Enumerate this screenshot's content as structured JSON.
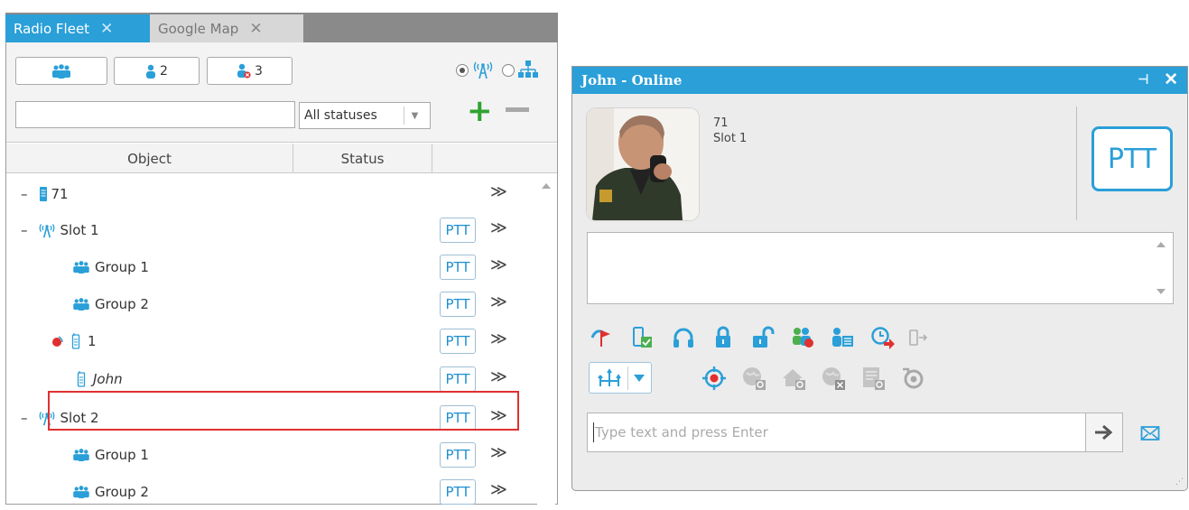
{
  "tabs": [
    {
      "label": "Radio Fleet",
      "close": "✕"
    },
    {
      "label": "Google Map",
      "close": "✕"
    }
  ],
  "filters": {
    "all_count": "",
    "online_count": "2",
    "offline_count": "3",
    "search_value": "",
    "status_select": "All statuses"
  },
  "columns": {
    "object": "Object",
    "status": "Status"
  },
  "tree": [
    {
      "prefix": "–",
      "label": "71",
      "icon": "repeater-icon",
      "italic": false,
      "ptt": false
    },
    {
      "prefix": "–",
      "label": "Slot 1",
      "icon": "antenna-icon",
      "italic": false,
      "ptt": true
    },
    {
      "prefix": "",
      "label": "Group 1",
      "icon": "talkgroup-icon",
      "italic": false,
      "ptt": true
    },
    {
      "prefix": "",
      "label": "Group 2",
      "icon": "talkgroup-icon",
      "italic": false,
      "ptt": true
    },
    {
      "prefix": "",
      "label": "1",
      "icon": "radio-icon",
      "italic": false,
      "ptt": true
    },
    {
      "prefix": "",
      "label": "John",
      "icon": "radio-icon",
      "italic": true,
      "ptt": true
    },
    {
      "prefix": "–",
      "label": "Slot 2",
      "icon": "antenna-icon",
      "italic": false,
      "ptt": true
    },
    {
      "prefix": "",
      "label": "Group 1",
      "icon": "talkgroup-icon",
      "italic": false,
      "ptt": true
    },
    {
      "prefix": "",
      "label": "Group 2",
      "icon": "talkgroup-icon",
      "italic": false,
      "ptt": true
    }
  ],
  "ptt_label": "PTT",
  "more_label": "≫",
  "window": {
    "title": "John - Online",
    "pin": "⊣",
    "close": "✕",
    "radio_id": "71",
    "slot": "Slot 1",
    "ptt": "PTT",
    "input_placeholder": "Type text and press Enter"
  },
  "colors": {
    "accent": "#2a9fd8",
    "highlight": "#e03030",
    "add": "#2fa32f"
  }
}
